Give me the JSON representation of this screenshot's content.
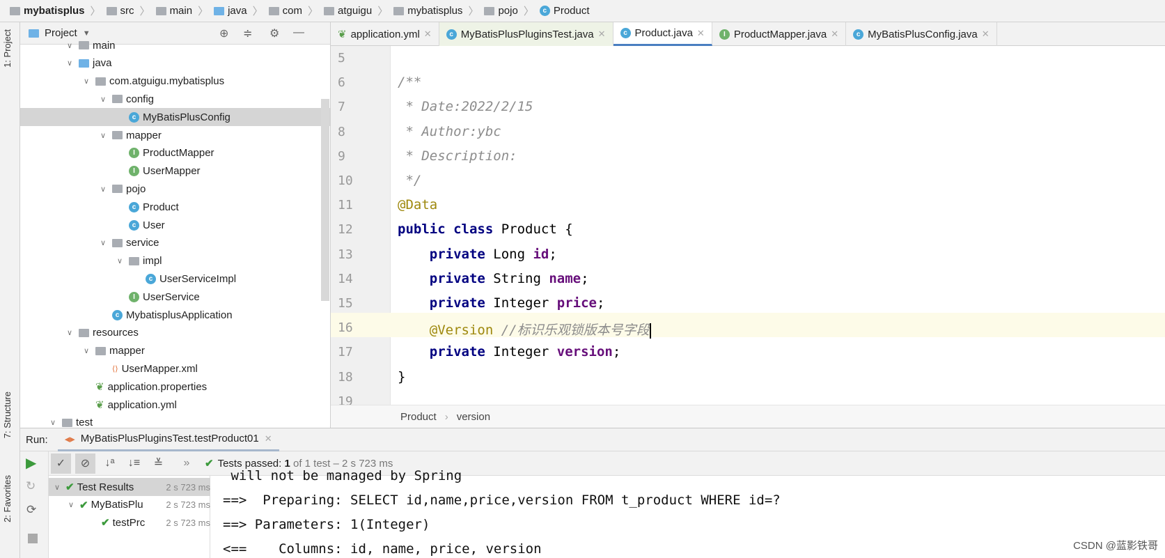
{
  "breadcrumb": [
    "mybatisplus",
    "src",
    "main",
    "java",
    "com",
    "atguigu",
    "mybatisplus",
    "pojo",
    "Product"
  ],
  "project_panel": {
    "title": "Project",
    "tree": [
      {
        "label": "main",
        "depth": 3,
        "type": "folder"
      },
      {
        "label": "java",
        "depth": 3,
        "type": "folder-blue"
      },
      {
        "label": "com.atguigu.mybatisplus",
        "depth": 4,
        "type": "package"
      },
      {
        "label": "config",
        "depth": 5,
        "type": "package"
      },
      {
        "label": "MyBatisPlusConfig",
        "depth": 6,
        "type": "class",
        "selected": true
      },
      {
        "label": "mapper",
        "depth": 5,
        "type": "package"
      },
      {
        "label": "ProductMapper",
        "depth": 6,
        "type": "interface"
      },
      {
        "label": "UserMapper",
        "depth": 6,
        "type": "interface"
      },
      {
        "label": "pojo",
        "depth": 5,
        "type": "package"
      },
      {
        "label": "Product",
        "depth": 6,
        "type": "class"
      },
      {
        "label": "User",
        "depth": 6,
        "type": "class"
      },
      {
        "label": "service",
        "depth": 5,
        "type": "package"
      },
      {
        "label": "impl",
        "depth": 6,
        "type": "package"
      },
      {
        "label": "UserServiceImpl",
        "depth": 7,
        "type": "class"
      },
      {
        "label": "UserService",
        "depth": 6,
        "type": "interface"
      },
      {
        "label": "MybatisplusApplication",
        "depth": 5,
        "type": "spring-class"
      },
      {
        "label": "resources",
        "depth": 3,
        "type": "folder"
      },
      {
        "label": "mapper",
        "depth": 4,
        "type": "folder"
      },
      {
        "label": "UserMapper.xml",
        "depth": 5,
        "type": "xml"
      },
      {
        "label": "application.properties",
        "depth": 4,
        "type": "spring"
      },
      {
        "label": "application.yml",
        "depth": 4,
        "type": "spring"
      },
      {
        "label": "test",
        "depth": 2,
        "type": "folder"
      }
    ]
  },
  "side_tabs": {
    "project": "1: Project",
    "structure": "7: Structure",
    "favorites": "2: Favorites"
  },
  "tabs": [
    {
      "label": "application.yml",
      "icon": "spring"
    },
    {
      "label": "MyBatisPlusPluginsTest.java",
      "icon": "test-class"
    },
    {
      "label": "Product.java",
      "icon": "class",
      "active": true
    },
    {
      "label": "ProductMapper.java",
      "icon": "interface"
    },
    {
      "label": "MyBatisPlusConfig.java",
      "icon": "class"
    }
  ],
  "editor": {
    "lines": [
      {
        "n": "5",
        "parts": []
      },
      {
        "n": "6",
        "parts": [
          {
            "t": "/**",
            "c": "cm"
          }
        ]
      },
      {
        "n": "7",
        "parts": [
          {
            "t": " * Date:2022/2/15",
            "c": "cm"
          }
        ]
      },
      {
        "n": "8",
        "parts": [
          {
            "t": " * Author:ybc",
            "c": "cm"
          }
        ]
      },
      {
        "n": "9",
        "parts": [
          {
            "t": " * Description:",
            "c": "cm"
          }
        ]
      },
      {
        "n": "10",
        "parts": [
          {
            "t": " */",
            "c": "cm"
          }
        ]
      },
      {
        "n": "11",
        "parts": [
          {
            "t": "@Data",
            "c": "an"
          }
        ]
      },
      {
        "n": "12",
        "parts": [
          {
            "t": "public class ",
            "c": "kw"
          },
          {
            "t": "Product {",
            "c": ""
          }
        ]
      },
      {
        "n": "13",
        "parts": [
          {
            "t": "    private ",
            "c": "kw"
          },
          {
            "t": "Long ",
            "c": ""
          },
          {
            "t": "id",
            "c": "fd"
          },
          {
            "t": ";",
            "c": ""
          }
        ]
      },
      {
        "n": "14",
        "parts": [
          {
            "t": "    private ",
            "c": "kw"
          },
          {
            "t": "String ",
            "c": ""
          },
          {
            "t": "name",
            "c": "fd"
          },
          {
            "t": ";",
            "c": ""
          }
        ]
      },
      {
        "n": "15",
        "parts": [
          {
            "t": "    private ",
            "c": "kw"
          },
          {
            "t": "Integer ",
            "c": ""
          },
          {
            "t": "price",
            "c": "fd"
          },
          {
            "t": ";",
            "c": ""
          }
        ]
      },
      {
        "n": "16",
        "parts": [
          {
            "t": "    @Version ",
            "c": "an"
          },
          {
            "t": "//标识乐观锁版本号字段",
            "c": "cm"
          }
        ]
      },
      {
        "n": "17",
        "parts": [
          {
            "t": "    private ",
            "c": "kw"
          },
          {
            "t": "Integer ",
            "c": ""
          },
          {
            "t": "version",
            "c": "fd"
          },
          {
            "t": ";",
            "c": ""
          }
        ]
      },
      {
        "n": "18",
        "parts": [
          {
            "t": "}",
            "c": ""
          }
        ]
      },
      {
        "n": "19",
        "parts": []
      }
    ],
    "breadcrumb": [
      "Product",
      "version"
    ]
  },
  "run": {
    "label": "Run:",
    "tab": "MyBatisPlusPluginsTest.testProduct01",
    "status_prefix": "Tests passed:",
    "status_count": "1",
    "status_rest": "of 1 test – 2 s 723 ms",
    "tree": [
      {
        "label": "Test Results",
        "time": "2 s 723 ms"
      },
      {
        "label": "MyBatisPlu",
        "time": "2 s 723 ms"
      },
      {
        "label": "testPrc",
        "time": "2 s 723 ms"
      }
    ],
    "console": [
      " will not be managed by Spring",
      "==>  Preparing: SELECT id,name,price,version FROM t_product WHERE id=?",
      "==> Parameters: 1(Integer)",
      "<==    Columns: id, name, price, version"
    ]
  },
  "watermark": "CSDN @蓝影铁哥",
  "colors": {
    "accent": "#4a7fc1",
    "keyword": "#000080",
    "field": "#660e7a",
    "annotation": "#9e880d",
    "comment": "#8c8c8c",
    "pass": "#3c9a3c"
  }
}
